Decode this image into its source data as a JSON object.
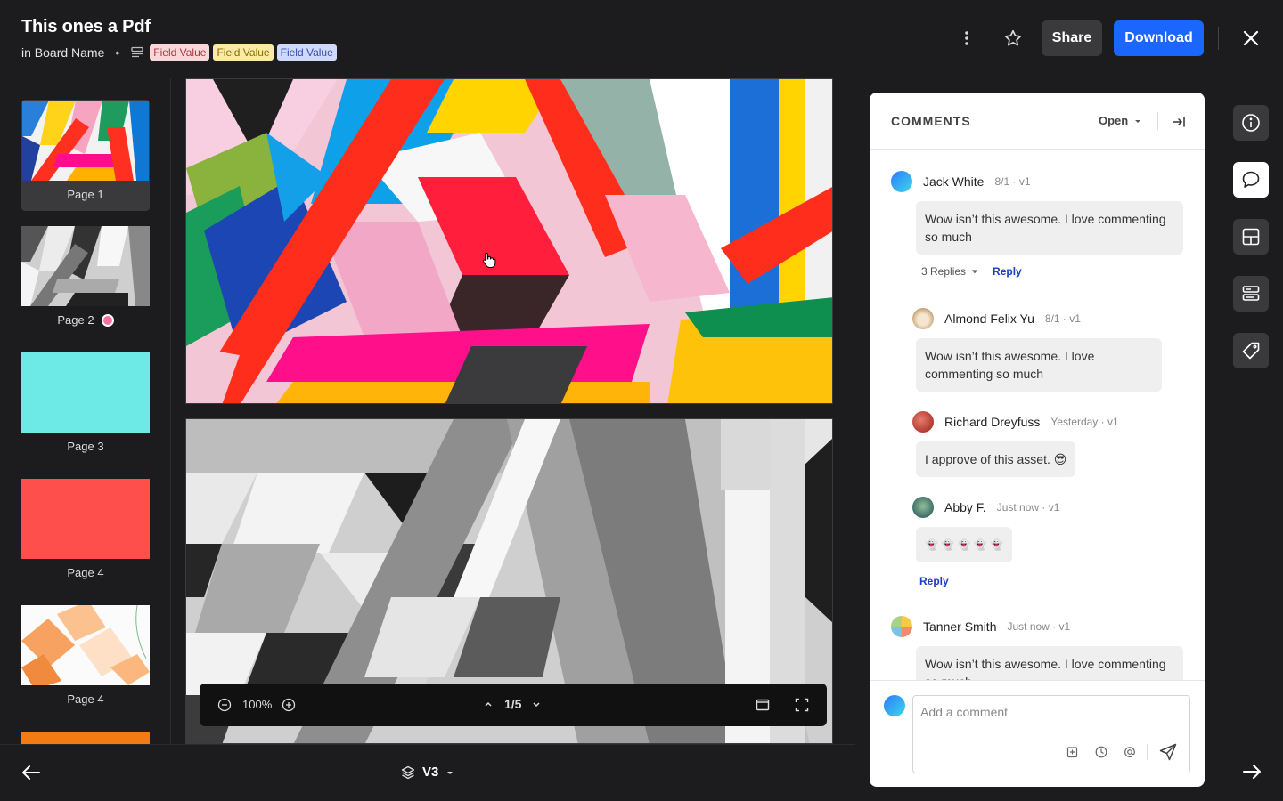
{
  "header": {
    "title": "This ones a Pdf",
    "board": "in Board Name",
    "separator": "•",
    "tags": [
      "Field Value",
      "Field Value",
      "Field Value"
    ],
    "share_label": "Share",
    "download_label": "Download"
  },
  "sidebar": {
    "pages": [
      {
        "label": "Page 1"
      },
      {
        "label": "Page 2"
      },
      {
        "label": "Page 3"
      },
      {
        "label": "Page 4"
      },
      {
        "label": "Page 4"
      }
    ]
  },
  "toolbar": {
    "zoom": "100%",
    "page_indicator": "1/5"
  },
  "bottom": {
    "version": "V3"
  },
  "comments": {
    "title": "COMMENTS",
    "filter": "Open",
    "items": [
      {
        "name": "Jack White",
        "meta": "8/1 · v1",
        "text": "Wow isn’t this awesome. I love commenting so much",
        "replies_label": "3 Replies",
        "reply_label": "Reply"
      },
      {
        "name": "Almond Felix Yu",
        "meta": "8/1 · v1",
        "text": "Wow isn’t this awesome. I love commenting so much"
      },
      {
        "name": "Richard Dreyfuss",
        "meta": "Yesterday · v1",
        "text": "I approve of this asset. 😎"
      },
      {
        "name": "Abby F.",
        "meta": "Just now · v1",
        "text": "👻 👻 👻 👻 👻",
        "reply_label": "Reply"
      },
      {
        "name": "Tanner Smith",
        "meta": "Just now · v1",
        "text": "Wow isn’t this awesome. I love commenting so much"
      }
    ],
    "input_placeholder": "Add a comment"
  },
  "colors": {
    "accent": "#1a66ff",
    "link": "#1a3fc1",
    "background": "#1c1c1e"
  },
  "icons": [
    "more-vertical-icon",
    "star-icon",
    "close-icon",
    "info-icon",
    "comment-icon",
    "layout-icon",
    "fields-icon",
    "tag-icon",
    "arrow-left-icon",
    "arrow-right-icon",
    "layers-icon",
    "zoom-out-icon",
    "zoom-in-icon",
    "chevron-up-icon",
    "chevron-down-icon",
    "fit-icon",
    "fullscreen-icon",
    "collapse-panel-icon",
    "attach-icon",
    "clock-icon",
    "mention-icon",
    "send-icon"
  ]
}
